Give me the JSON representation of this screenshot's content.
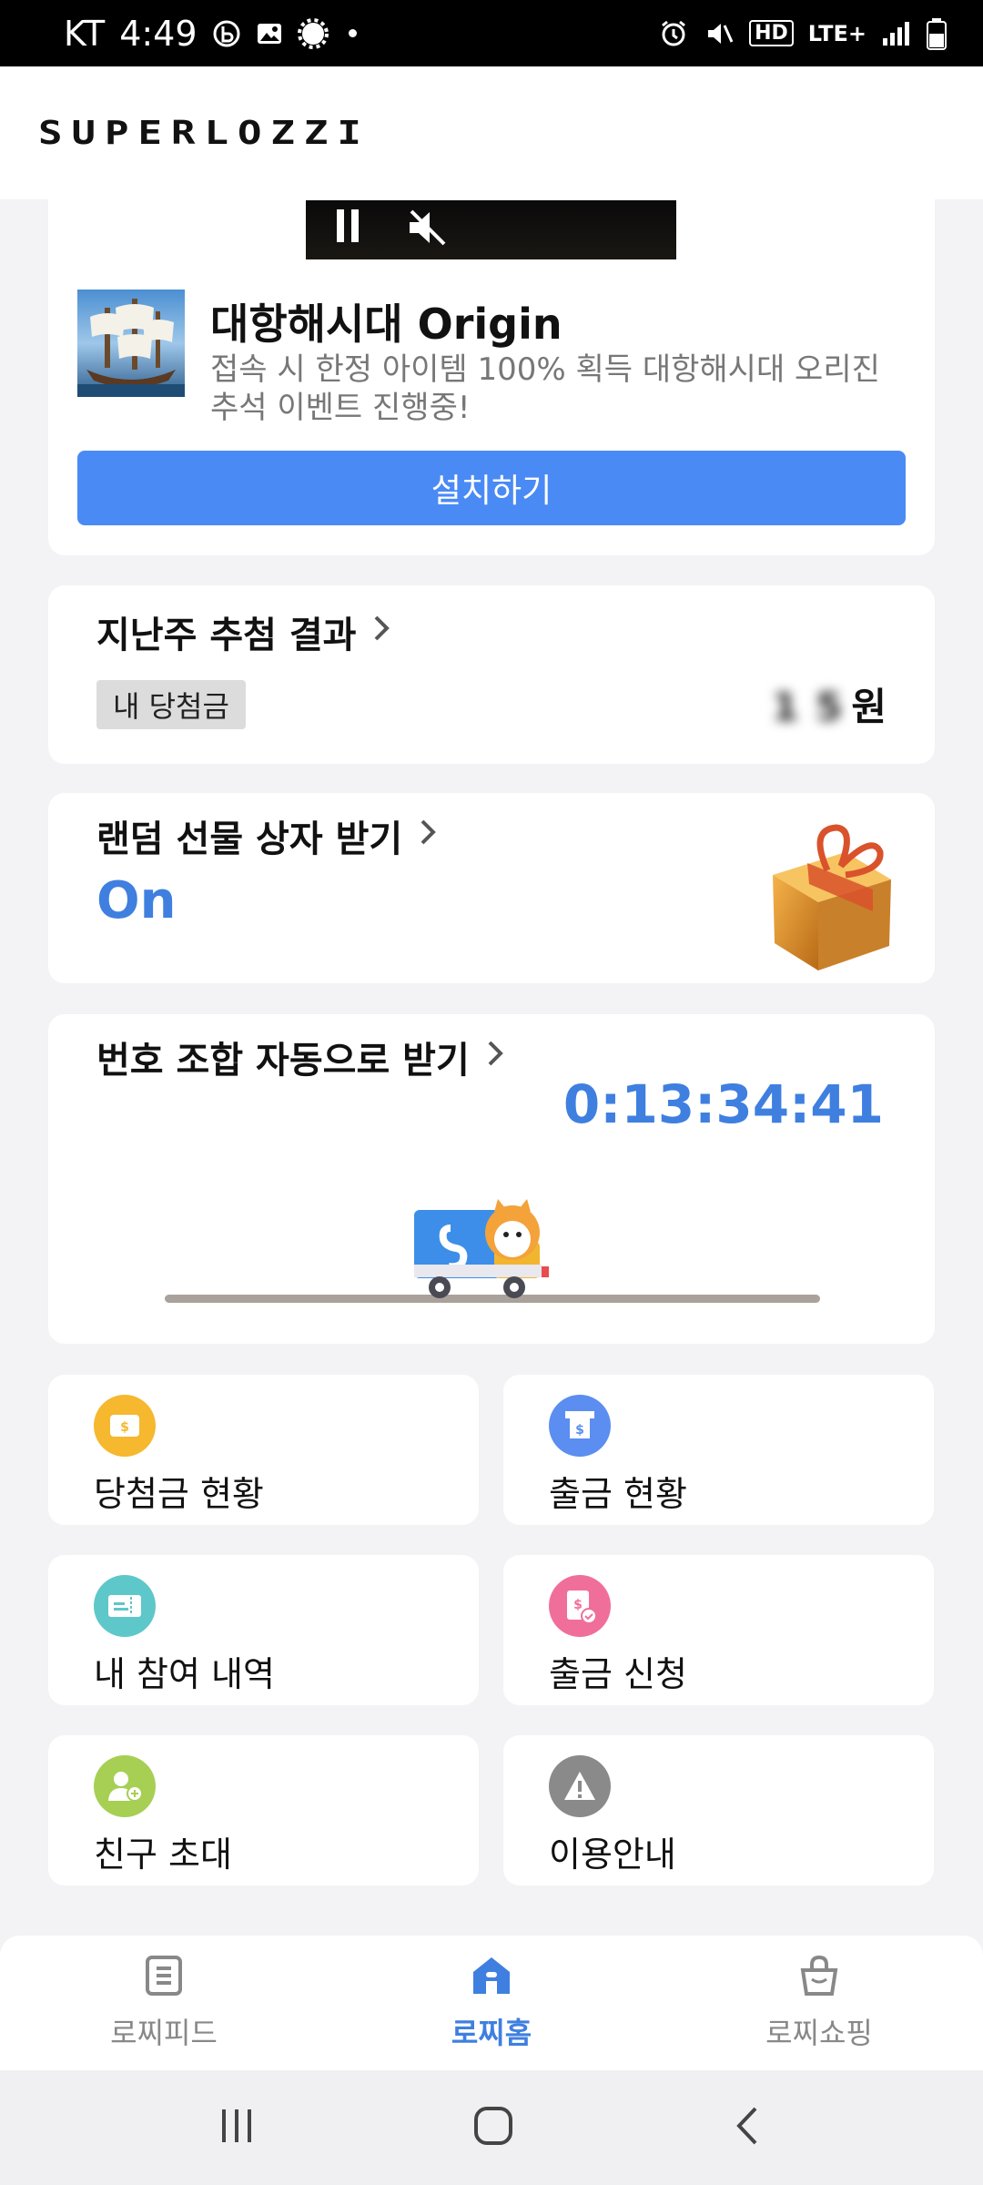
{
  "status_bar": {
    "carrier": "KT",
    "time": "4:49",
    "network": "LTE+",
    "hd_label": "HD"
  },
  "header": {
    "logo": "SUPERLOZZI"
  },
  "ad": {
    "title": "대항해시대 Origin",
    "description": "접속 시 한정 아이템 100% 획득 대항해시대 오리진 추석 이벤트 진행중!",
    "install_label": "설치하기"
  },
  "last_week_result": {
    "title": "지난주 추첨 결과",
    "badge": "내 당첨금",
    "amount_hidden": "1 5",
    "currency": "원"
  },
  "random_gift": {
    "title": "랜덤 선물 상자 받기",
    "status": "On"
  },
  "auto_numbers": {
    "title": "번호 조합 자동으로 받기",
    "countdown": "0:13:34:41"
  },
  "menu": [
    {
      "label": "당첨금 현황",
      "icon": "wallet-icon",
      "color": "#f5b82e"
    },
    {
      "label": "출금 현황",
      "icon": "atm-icon",
      "color": "#5b8ef0"
    },
    {
      "label": "내 참여 내역",
      "icon": "ticket-icon",
      "color": "#5ec7c9"
    },
    {
      "label": "출금 신청",
      "icon": "withdraw-request-icon",
      "color": "#f06f9a"
    },
    {
      "label": "친구 초대",
      "icon": "add-friend-icon",
      "color": "#a6cf54"
    },
    {
      "label": "이용안내",
      "icon": "warning-icon",
      "color": "#8a8a8a"
    }
  ],
  "bottom_nav": {
    "items": [
      {
        "label": "로찌피드",
        "icon": "feed-icon",
        "active": false
      },
      {
        "label": "로찌홈",
        "icon": "home-icon",
        "active": true
      },
      {
        "label": "로찌쇼핑",
        "icon": "shopping-bag-icon",
        "active": false
      }
    ]
  },
  "colors": {
    "accent": "#3f7fe0",
    "install_button": "#4a8af4"
  }
}
